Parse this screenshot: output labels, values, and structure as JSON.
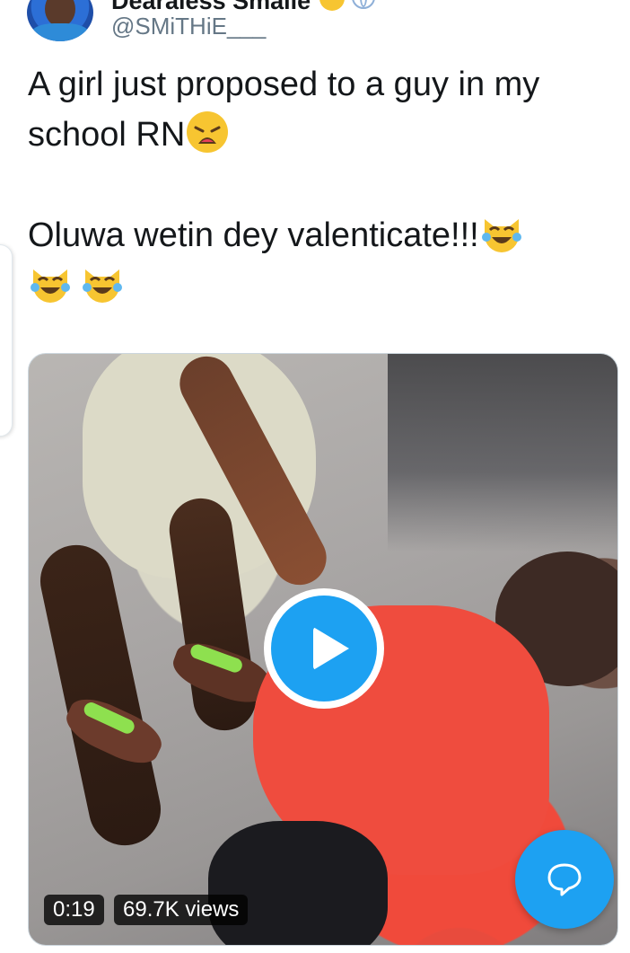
{
  "header": {
    "display_name": "Dearaless Smalle",
    "handle": "@SMiTHiE___",
    "avatar_icon": "avatar-photo",
    "verified_icon": "globe-icon"
  },
  "tweet": {
    "line1": "A girl just proposed to a guy in my school RN",
    "line1_emoji": "weary-face-emoji",
    "line2": "Oluwa wetin dey valenticate!!!",
    "line2_emoji": "cat-face-with-tears-of-joy-emoji",
    "extra_emoji_count": 2
  },
  "video": {
    "duration": "0:19",
    "views": "69.7K views",
    "play_icon": "play-icon"
  },
  "compose": {
    "icon": "chat-bubble-icon"
  },
  "colors": {
    "accent": "#1da1f2",
    "text": "#14171a",
    "secondary": "#657786"
  }
}
